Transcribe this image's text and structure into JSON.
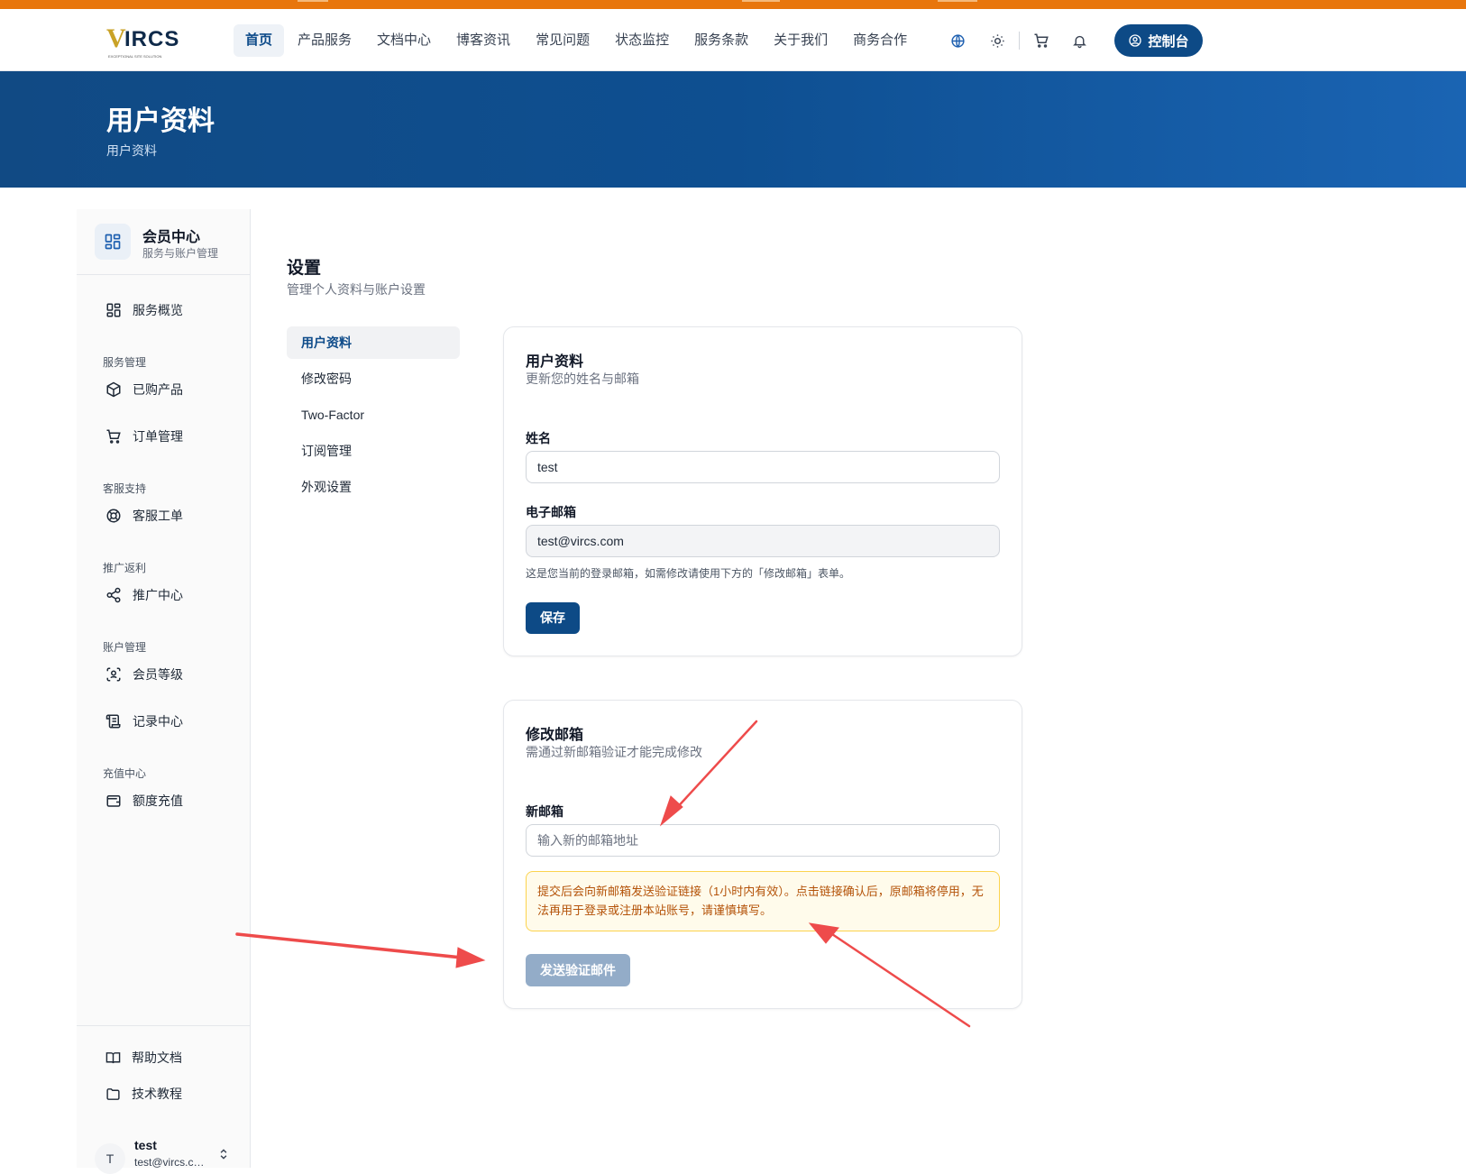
{
  "brand": {
    "logo_text": "IRCS",
    "logo_v": "V",
    "logo_tagline": "EXCEPTIONAL SITE SOLUTION"
  },
  "nav": {
    "items": [
      {
        "label": "首页",
        "active": true
      },
      {
        "label": "产品服务"
      },
      {
        "label": "文档中心"
      },
      {
        "label": "博客资讯"
      },
      {
        "label": "常见问题"
      },
      {
        "label": "状态监控"
      },
      {
        "label": "服务条款"
      },
      {
        "label": "关于我们"
      },
      {
        "label": "商务合作"
      }
    ],
    "console_label": "控制台"
  },
  "hero": {
    "title": "用户资料",
    "breadcrumb": "用户资料"
  },
  "sidebar": {
    "title": "会员中心",
    "subtitle": "服务与账户管理",
    "overview": "服务概览",
    "groups": [
      {
        "label": "服务管理",
        "items": [
          "已购产品",
          "订单管理"
        ]
      },
      {
        "label": "客服支持",
        "items": [
          "客服工单"
        ]
      },
      {
        "label": "推广返利",
        "items": [
          "推广中心"
        ]
      },
      {
        "label": "账户管理",
        "items": [
          "会员等级",
          "记录中心"
        ]
      },
      {
        "label": "充值中心",
        "items": [
          "额度充值"
        ]
      }
    ],
    "footer": [
      "帮助文档",
      "技术教程"
    ],
    "user": {
      "initial": "T",
      "name": "test",
      "email": "test@vircs.com"
    }
  },
  "settings": {
    "title": "设置",
    "subtitle": "管理个人资料与账户设置",
    "nav": [
      "用户资料",
      "修改密码",
      "Two-Factor",
      "订阅管理",
      "外观设置"
    ]
  },
  "profile_card": {
    "title": "用户资料",
    "subtitle": "更新您的姓名与邮箱",
    "name_label": "姓名",
    "name_value": "test",
    "email_label": "电子邮箱",
    "email_value": "test@vircs.com",
    "email_hint": "这是您当前的登录邮箱，如需修改请使用下方的「修改邮箱」表单。",
    "save_label": "保存"
  },
  "email_card": {
    "title": "修改邮箱",
    "subtitle": "需通过新邮箱验证才能完成修改",
    "new_email_label": "新邮箱",
    "new_email_placeholder": "输入新的邮箱地址",
    "warning_line1": "提交后会向新邮箱发送验证链接（1小时内有效）。点击链接确认后，原邮箱将停用，无",
    "warning_line2": "法再用于登录或注册本站账号，请谨慎填写。",
    "send_label": "发送验证邮件"
  },
  "colors": {
    "primary": "#0d4a86",
    "accent": "#e8760c",
    "annotation": "#ee4b4b"
  }
}
